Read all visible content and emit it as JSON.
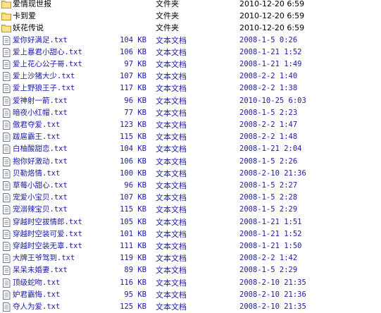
{
  "rows": [
    {
      "kind": "folder",
      "name": "爱情现世报",
      "size": "",
      "type": "文件夹",
      "date": "2010-12-20 6:59"
    },
    {
      "kind": "folder",
      "name": "卡到爱",
      "size": "",
      "type": "文件夹",
      "date": "2010-12-20 6:59"
    },
    {
      "kind": "folder",
      "name": "妖花传说",
      "size": "",
      "type": "文件夹",
      "date": "2010-12-20 6:59"
    },
    {
      "kind": "file",
      "name": "爱你好满足.txt",
      "size": "104 KB",
      "type": "文本文档",
      "date": "2008-1-5 0:26"
    },
    {
      "kind": "file",
      "name": "爱上暴君小甜心.txt",
      "size": "106 KB",
      "type": "文本文档",
      "date": "2008-1-21 1:52"
    },
    {
      "kind": "file",
      "name": "爱上花心公子哥.txt",
      "size": "97 KB",
      "type": "文本文档",
      "date": "2008-1-21 1:49"
    },
    {
      "kind": "file",
      "name": "爱上沙猪大少.txt",
      "size": "107 KB",
      "type": "文本文档",
      "date": "2008-2-2 1:40"
    },
    {
      "kind": "file",
      "name": "爱上野狼王子.txt",
      "size": "117 KB",
      "type": "文本文档",
      "date": "2008-2-2 1:38"
    },
    {
      "kind": "file",
      "name": "爱神射一箭.txt",
      "size": "96 KB",
      "type": "文本文档",
      "date": "2010-10-25 6:03"
    },
    {
      "kind": "file",
      "name": "暗夜小红帽.txt",
      "size": "77 KB",
      "type": "文本文档",
      "date": "2008-1-5 2:23"
    },
    {
      "kind": "file",
      "name": "傲君夺爱.txt",
      "size": "123 KB",
      "type": "文本文档",
      "date": "2008-2-2 1:47"
    },
    {
      "kind": "file",
      "name": "跋扈霸王.txt",
      "size": "115 KB",
      "type": "文本文档",
      "date": "2008-2-2 1:48"
    },
    {
      "kind": "file",
      "name": "白柚酸甜恋.txt",
      "size": "104 KB",
      "type": "文本文档",
      "date": "2008-1-21 2:04"
    },
    {
      "kind": "file",
      "name": "抱你好激动.txt",
      "size": "106 KB",
      "type": "文本文档",
      "date": "2008-1-5 2:26"
    },
    {
      "kind": "file",
      "name": "贝勒烙情.txt",
      "size": "100 KB",
      "type": "文本文档",
      "date": "2008-2-10 21:36"
    },
    {
      "kind": "file",
      "name": "草莓小甜心.txt",
      "size": "96 KB",
      "type": "文本文档",
      "date": "2008-1-5 2:27"
    },
    {
      "kind": "file",
      "name": "宠爱小宝贝.txt",
      "size": "107 KB",
      "type": "文本文档",
      "date": "2008-1-5 2:28"
    },
    {
      "kind": "file",
      "name": "宠溺辣宝贝.txt",
      "size": "115 KB",
      "type": "文本文档",
      "date": "2008-1-5 2:29"
    },
    {
      "kind": "file",
      "name": "穿越时空拔情郎.txt",
      "size": "105 KB",
      "type": "文本文档",
      "date": "2008-1-21 1:51"
    },
    {
      "kind": "file",
      "name": "穿越时空装可爱.txt",
      "size": "101 KB",
      "type": "文本文档",
      "date": "2008-1-21 1:52"
    },
    {
      "kind": "file",
      "name": "穿越时空装无辜.txt",
      "size": "111 KB",
      "type": "文本文档",
      "date": "2008-1-21 1:50"
    },
    {
      "kind": "file",
      "name": "大牌王爷驾到.txt",
      "size": "119 KB",
      "type": "文本文档",
      "date": "2008-2-2 1:42"
    },
    {
      "kind": "file",
      "name": "呆呆未婚妻.txt",
      "size": "89 KB",
      "type": "文本文档",
      "date": "2008-1-5 2:29"
    },
    {
      "kind": "file",
      "name": "顶级蛇吻.txt",
      "size": "116 KB",
      "type": "文本文档",
      "date": "2008-2-10 21:35"
    },
    {
      "kind": "file",
      "name": "妒君霸悔.txt",
      "size": "95 KB",
      "type": "文本文档",
      "date": "2008-2-10 21:36"
    },
    {
      "kind": "file",
      "name": "夺人为爱.txt",
      "size": "125 KB",
      "type": "文本文档",
      "date": "2008-2-10 21:35"
    }
  ]
}
